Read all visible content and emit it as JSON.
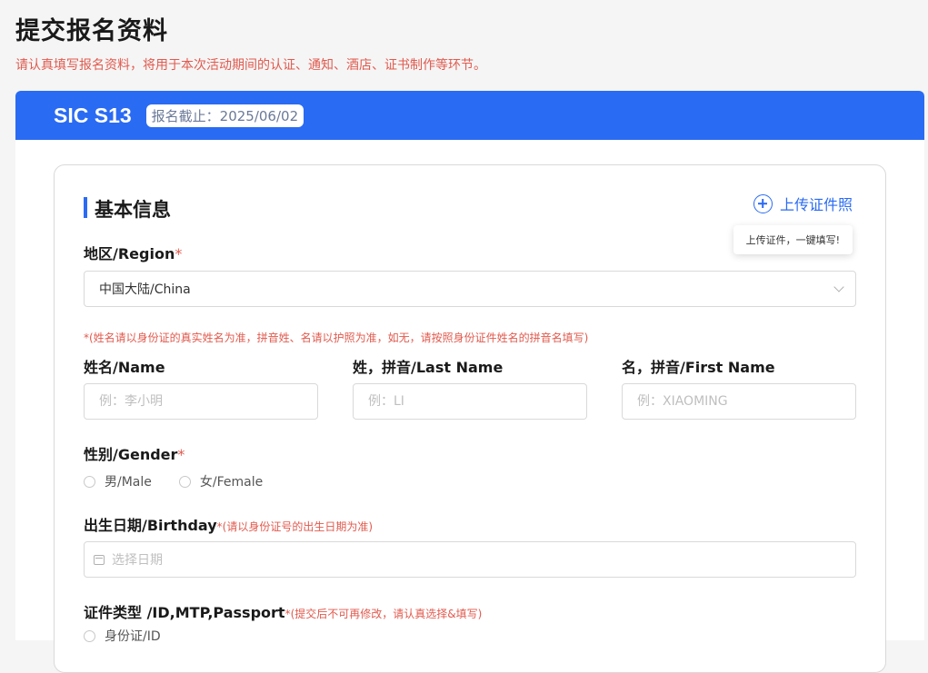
{
  "header": {
    "title": "提交报名资料",
    "subtitle": "请认真填写报名资料，将用于本次活动期间的认证、通知、酒店、证书制作等环节。"
  },
  "event": {
    "name": "SIC S13",
    "deadline": "报名截止：2025/06/02"
  },
  "section": {
    "title": "基本信息",
    "upload_label": "上传证件照",
    "upload_tooltip": "上传证件，一键填写!"
  },
  "region": {
    "label": "地区/Region",
    "required_mark": "*",
    "selected": "中国大陆/China"
  },
  "name_hint": "*(姓名请以身份证的真实姓名为准，拼音姓、名请以护照为准，如无，请按照身份证件姓名的拼音名填写)",
  "name": {
    "label": "姓名/Name",
    "placeholder": "例：李小明"
  },
  "last_name": {
    "label": "姓，拼音/Last Name",
    "placeholder": "例：LI"
  },
  "first_name": {
    "label": "名，拼音/First Name",
    "placeholder": "例：XIAOMING"
  },
  "gender": {
    "label": "性别/Gender",
    "required_mark": "*",
    "options": [
      "男/Male",
      "女/Female"
    ]
  },
  "birthday": {
    "label": "出生日期/Birthday",
    "hint": "*(请以身份证号的出生日期为准)",
    "placeholder": "选择日期"
  },
  "id_type": {
    "label": "证件类型 /ID,MTP,Passport",
    "hint": "*(提交后不可再修改，请认真选择&填写)",
    "options": [
      "身份证/ID"
    ]
  },
  "colors": {
    "accent": "#2a6bf3",
    "required": "#e15a4e"
  }
}
